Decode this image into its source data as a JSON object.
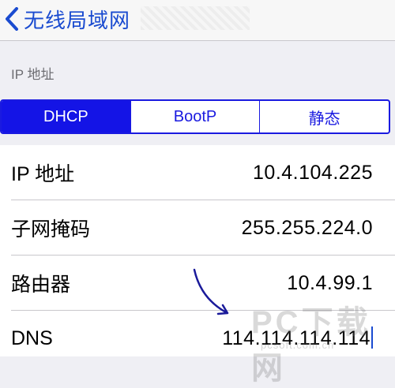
{
  "nav": {
    "back_label": "无线局域网"
  },
  "section": {
    "header": "IP 地址"
  },
  "segmented": {
    "options": [
      "DHCP",
      "BootP",
      "静态"
    ],
    "selected": "DHCP"
  },
  "fields": [
    {
      "label": "IP 地址",
      "value": "10.4.104.225"
    },
    {
      "label": "子网掩码",
      "value": "255.255.224.0"
    },
    {
      "label": "路由器",
      "value": "10.4.99.1"
    },
    {
      "label": "DNS",
      "value": "114.114.114.114"
    }
  ],
  "watermark": {
    "text": "PC下载网",
    "url": "pcsoft.com.cn"
  },
  "colors": {
    "accent": "#1414e6",
    "link": "#1a4bd0"
  }
}
